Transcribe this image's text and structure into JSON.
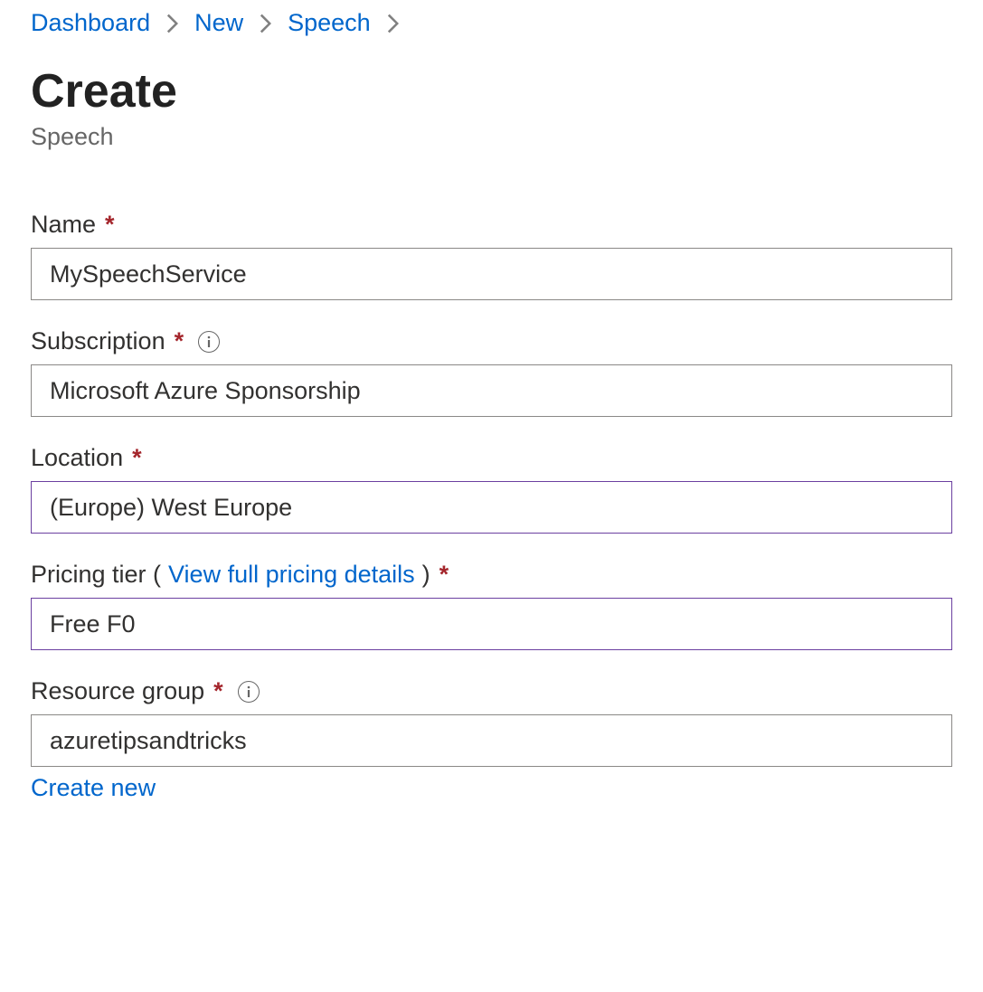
{
  "breadcrumb": {
    "items": [
      "Dashboard",
      "New",
      "Speech"
    ]
  },
  "header": {
    "title": "Create",
    "subtitle": "Speech"
  },
  "form": {
    "name": {
      "label": "Name",
      "value": "MySpeechService"
    },
    "subscription": {
      "label": "Subscription",
      "value": "Microsoft Azure Sponsorship"
    },
    "location": {
      "label": "Location",
      "value": "(Europe) West Europe"
    },
    "pricing": {
      "label_prefix": "Pricing tier (",
      "link_text": "View full pricing details",
      "label_suffix": ")",
      "value": "Free F0"
    },
    "resource_group": {
      "label": "Resource group",
      "value": "azuretipsandtricks",
      "create_new": "Create new"
    }
  }
}
